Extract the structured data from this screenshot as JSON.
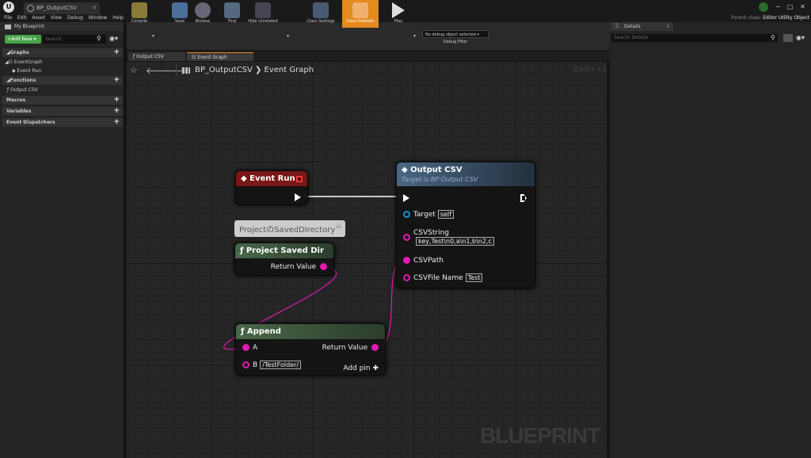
{
  "window": {
    "tab_title": "BP_OutputCSV",
    "logo": "U",
    "controls": [
      "−",
      "□",
      "✕"
    ]
  },
  "menu": [
    "File",
    "Edit",
    "Asset",
    "View",
    "Debug",
    "Window",
    "Help"
  ],
  "parent_class": {
    "label": "Parent class:",
    "value": "Editor Utility Object"
  },
  "left_panel": {
    "tab_title": "My Blueprint",
    "add_new": "+Add New ▾",
    "search_placeholder": "Search",
    "sections": {
      "graphs": "◢Graphs",
      "event_graph": "◢☷ EventGraph",
      "event_run": "◆ Event Run",
      "functions": "◢Functions",
      "output_csv": "ƒ Output CSV",
      "macros": "Macros",
      "variables": "Variables",
      "event_dispatchers": "Event Dispatchers"
    }
  },
  "toolbar": {
    "compile": "Compile",
    "save": "Save",
    "browse": "Browse",
    "find": "Find",
    "hide_unrelated": "Hide Unrelated",
    "class_settings": "Class Settings",
    "class_defaults": "Class Defaults",
    "play": "Play",
    "debug_select": "No debug object selected ▾",
    "debug_filter": "Debug Filter"
  },
  "graph_tabs": [
    "ƒ Output CSV",
    "☷ Event Graph"
  ],
  "graph": {
    "breadcrumb": "BP_OutputCSV ❯ Event Graph",
    "zoom": "Zoom +3",
    "watermark": "BLUEPRINT",
    "comment": "ProjectのSavedDIrectory",
    "event_run": {
      "title": "◆ Event Run"
    },
    "output_csv": {
      "title": "◆ Output CSV",
      "subtitle": "Target is BP Output CSV",
      "target_label": "Target",
      "target_value": "self",
      "csvstring_label": "CSVString",
      "csvstring_value": "key,Test\\n0,a\\n1,b\\n2,c",
      "csvpath_label": "CSVPath",
      "csvfilename_label": "CSVFile Name",
      "csvfilename_value": "Test"
    },
    "project_saved_dir": {
      "title": "ƒ Project Saved Dir",
      "return_label": "Return Value"
    },
    "append": {
      "title": "ƒ Append",
      "a_label": "A",
      "b_label": "B",
      "b_value": "/TestFolder/",
      "return_label": "Return Value",
      "add_pin": "Add pin ✚"
    }
  },
  "right_panel": {
    "tab_title": "Details",
    "search_placeholder": "Search Details"
  },
  "colors": {
    "accent_orange": "#e58a1e",
    "event_red": "#8a1a1a",
    "func_blue": "#3f5d7a",
    "func_green": "#3d5a3a",
    "string_pin": "#e11ab0",
    "object_pin": "#1b8fd6"
  }
}
